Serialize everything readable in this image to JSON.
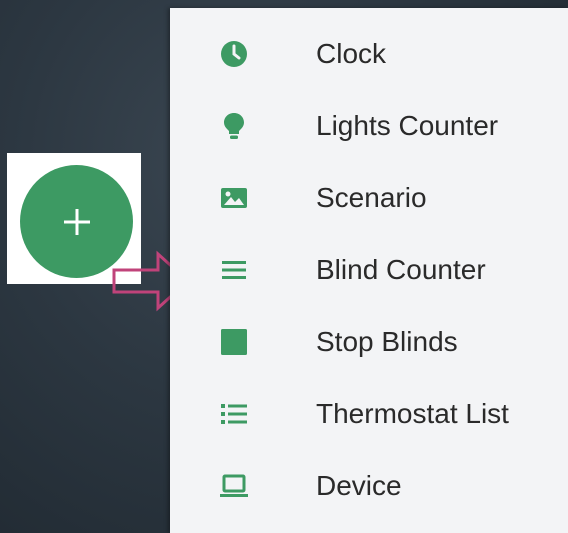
{
  "fab": {
    "icon": "plus-icon",
    "color": "#3d9a63"
  },
  "pointer": {
    "icon": "arrow-right-outline-icon",
    "color": "#c0437a"
  },
  "menu": {
    "accent_color": "#3d9a63",
    "items": [
      {
        "label": "Clock",
        "icon": "clock-icon"
      },
      {
        "label": "Lights Counter",
        "icon": "lightbulb-icon"
      },
      {
        "label": "Scenario",
        "icon": "image-icon"
      },
      {
        "label": "Blind Counter",
        "icon": "menu-lines-icon"
      },
      {
        "label": "Stop Blinds",
        "icon": "stop-square-icon"
      },
      {
        "label": "Thermostat List",
        "icon": "bullet-list-icon"
      },
      {
        "label": "Device",
        "icon": "laptop-icon"
      }
    ]
  }
}
